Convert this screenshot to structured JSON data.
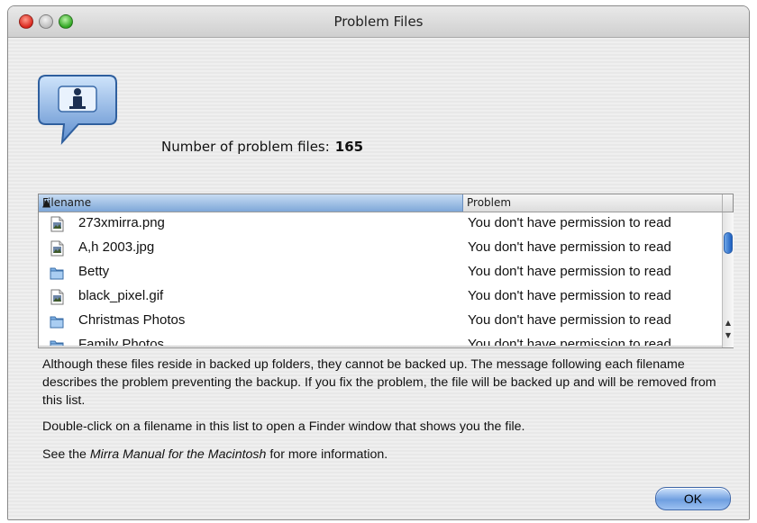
{
  "window": {
    "title": "Problem Files"
  },
  "header": {
    "count_label": "Number of problem files:",
    "count_value": "165"
  },
  "table": {
    "columns": [
      "Filename",
      "Problem"
    ],
    "sorted_column": "Filename",
    "rows": [
      {
        "filename": "273xmirra.png",
        "problem": "You don't have permission to read",
        "icon": "image-file-icon"
      },
      {
        "filename": "A,h 2003.jpg",
        "problem": "You don't have permission to read",
        "icon": "image-file-icon"
      },
      {
        "filename": "Betty",
        "problem": "You don't have permission to read",
        "icon": "folder-icon"
      },
      {
        "filename": "black_pixel.gif",
        "problem": "You don't have permission to read",
        "icon": "image-file-icon"
      },
      {
        "filename": "Christmas Photos",
        "problem": "You don't have permission to read",
        "icon": "folder-icon"
      },
      {
        "filename": "Family Photos",
        "problem": "You don't have permission to read",
        "icon": "folder-icon"
      }
    ]
  },
  "body": {
    "paragraph": "Although these files reside in backed up folders, they cannot be backed up. The message following each filename describes the problem preventing the backup.  If you fix the problem, the file will be backed up and will be removed from this list.",
    "double_click_hint": "Double-click on a filename in this list to open a Finder window that shows you the file.",
    "see_prefix": "See the ",
    "manual_title": "Mirra Manual for the Macintosh",
    "see_suffix": " for more information."
  },
  "buttons": {
    "ok": "OK"
  }
}
